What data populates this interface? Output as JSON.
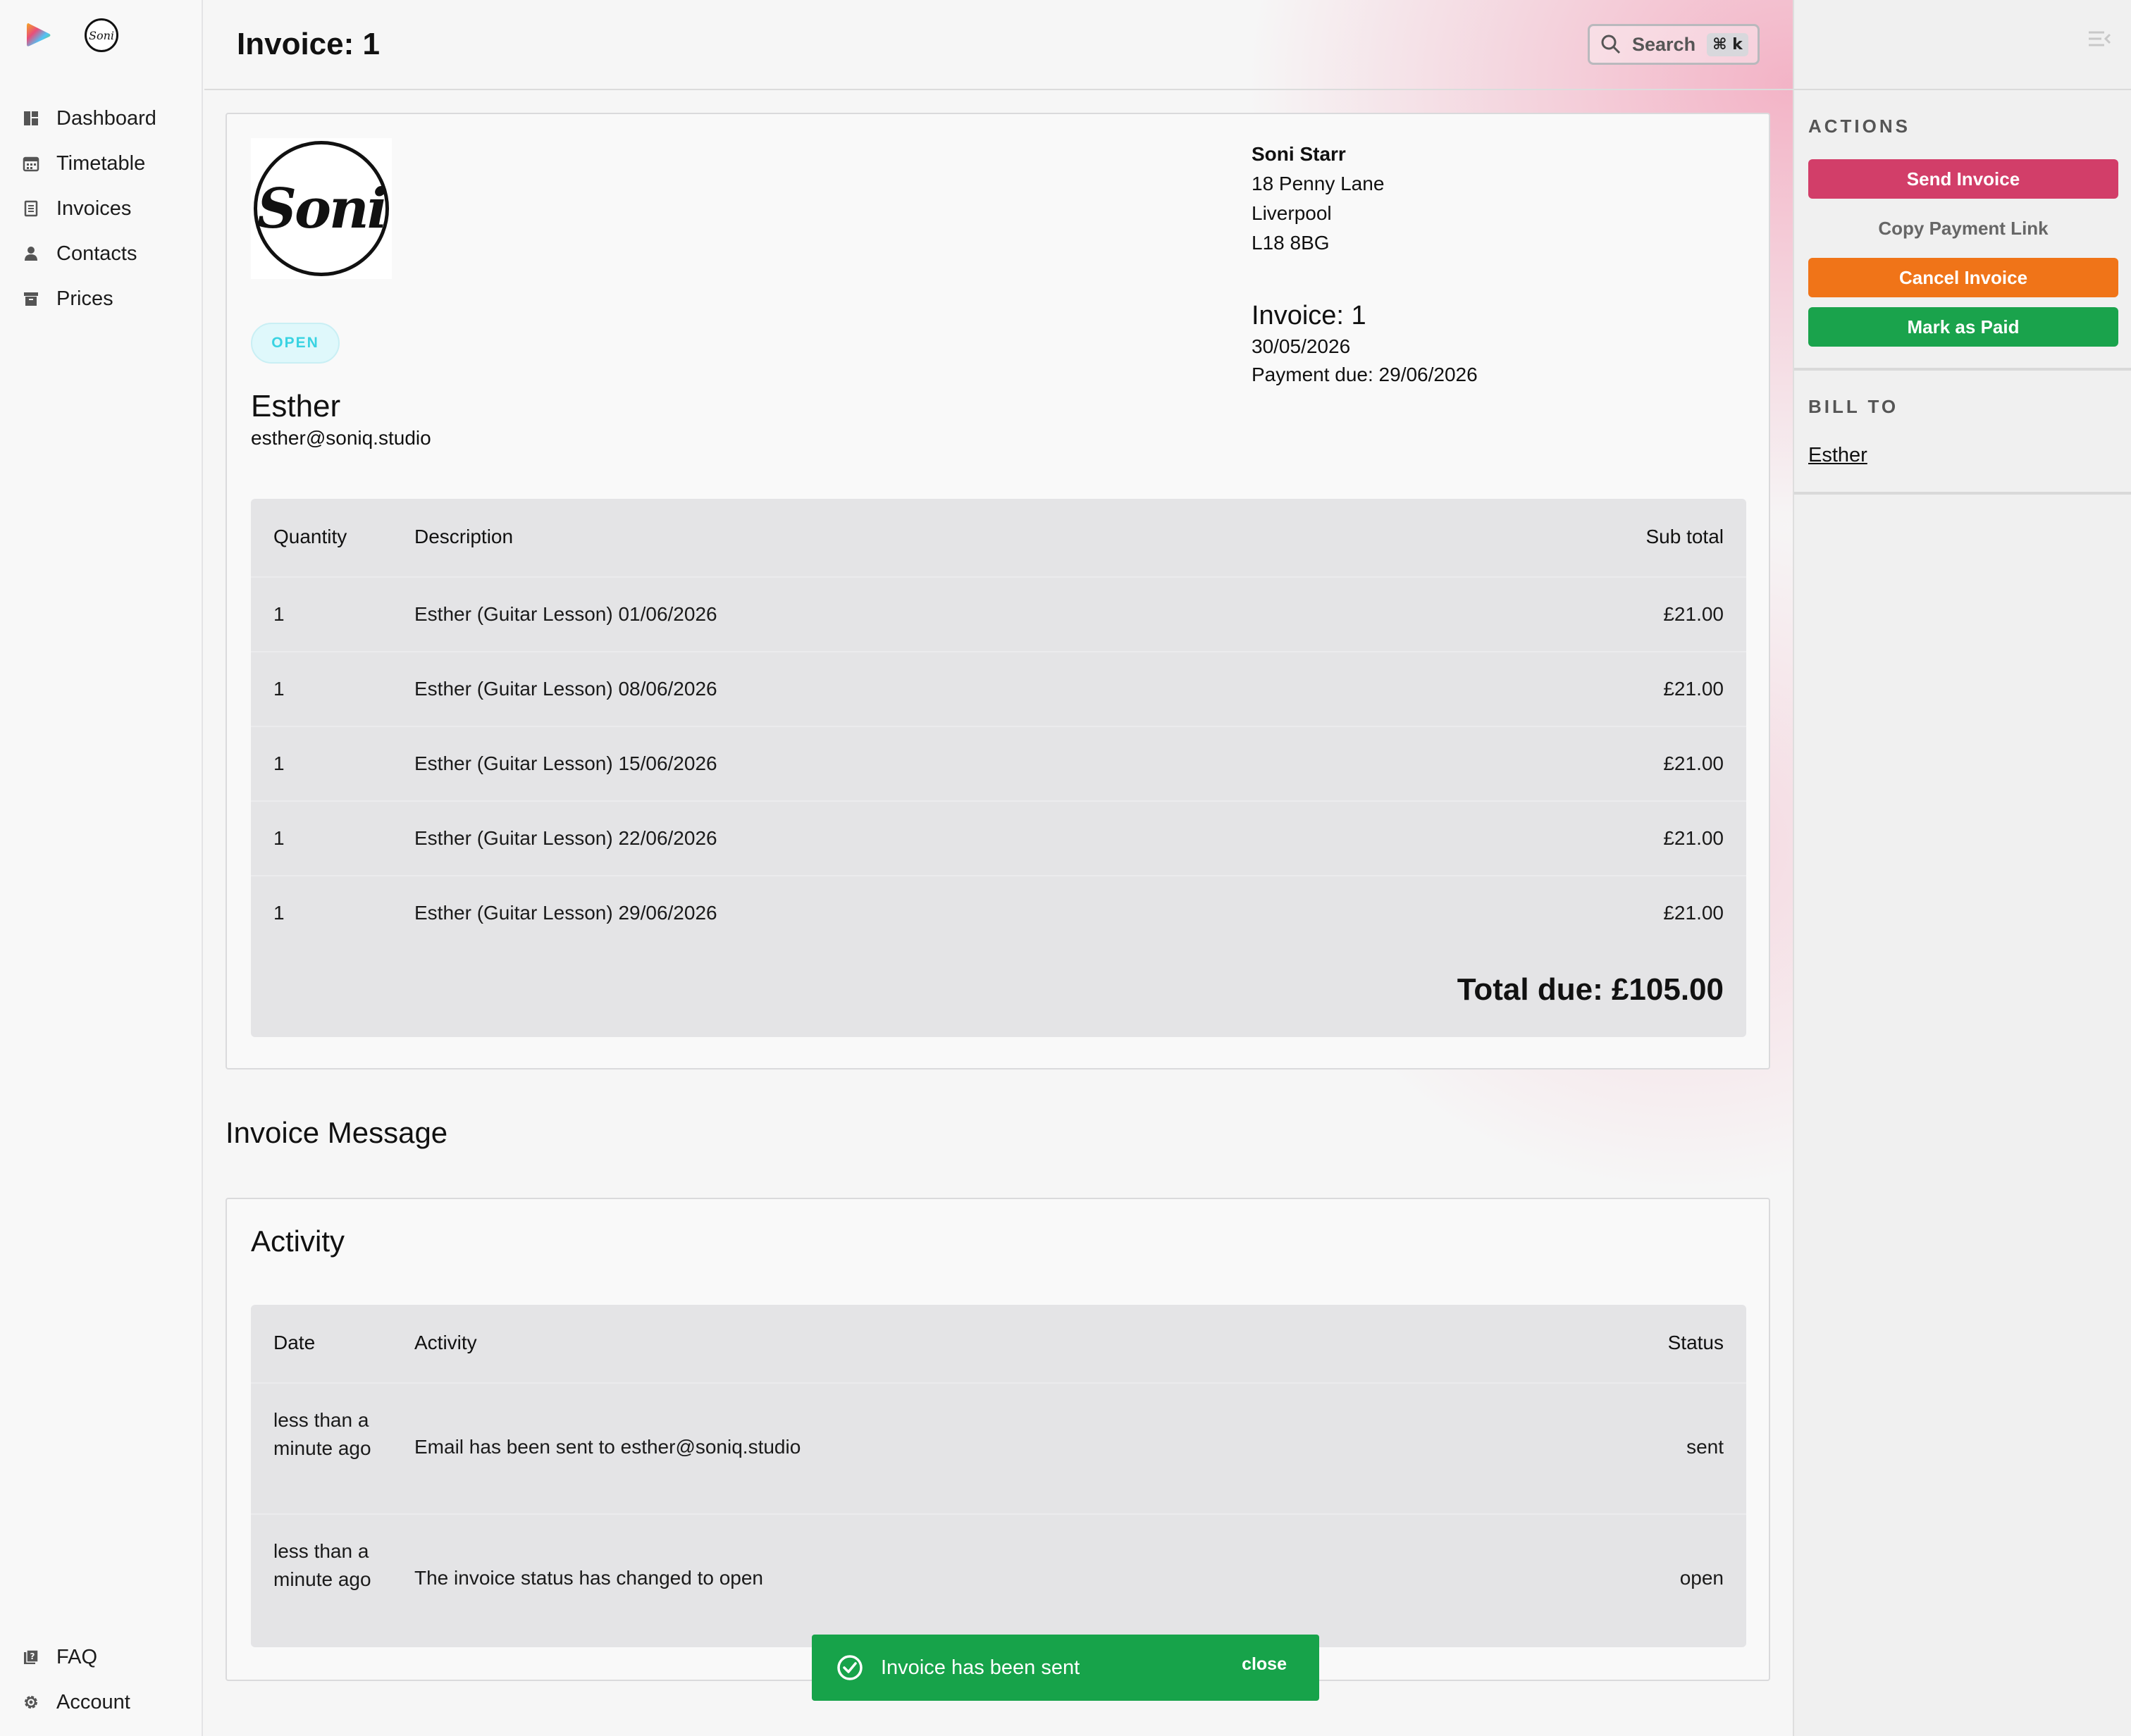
{
  "sidebar": {
    "items": [
      {
        "label": "Dashboard",
        "icon": "dashboard-icon"
      },
      {
        "label": "Timetable",
        "icon": "calendar-icon"
      },
      {
        "label": "Invoices",
        "icon": "invoice-icon"
      },
      {
        "label": "Contacts",
        "icon": "person-icon"
      },
      {
        "label": "Prices",
        "icon": "archive-icon"
      }
    ],
    "bottom": [
      {
        "label": "FAQ",
        "icon": "faq-icon"
      },
      {
        "label": "Account",
        "icon": "gear-icon"
      }
    ]
  },
  "header": {
    "title": "Invoice: 1",
    "search_label": "Search",
    "search_shortcut": "⌘ k"
  },
  "invoice": {
    "logo_text": "Soni",
    "status": "OPEN",
    "client_name": "Esther",
    "client_email": "esther@soniq.studio",
    "from": {
      "name": "Soni Starr",
      "address1": "18 Penny Lane",
      "city": "Liverpool",
      "postcode": "L18 8BG"
    },
    "number_label": "Invoice: 1",
    "date": "30/05/2026",
    "payment_due": "Payment due: 29/06/2026",
    "table": {
      "headers": [
        "Quantity",
        "Description",
        "Sub total"
      ],
      "rows": [
        [
          "1",
          "Esther (Guitar Lesson) 01/06/2026",
          "£21.00"
        ],
        [
          "1",
          "Esther (Guitar Lesson) 08/06/2026",
          "£21.00"
        ],
        [
          "1",
          "Esther (Guitar Lesson) 15/06/2026",
          "£21.00"
        ],
        [
          "1",
          "Esther (Guitar Lesson) 22/06/2026",
          "£21.00"
        ],
        [
          "1",
          "Esther (Guitar Lesson) 29/06/2026",
          "£21.00"
        ]
      ],
      "total": "Total due: £105.00"
    }
  },
  "message_title": "Invoice Message",
  "activity": {
    "title": "Activity",
    "headers": [
      "Date",
      "Activity",
      "Status"
    ],
    "rows": [
      [
        "less than a minute ago",
        "Email has been sent to esther@soniq.studio",
        "sent"
      ],
      [
        "less than a minute ago",
        "The invoice status has changed to open",
        "open"
      ]
    ]
  },
  "actions": {
    "label": "ACTIONS",
    "send": "Send Invoice",
    "copy": "Copy Payment Link",
    "cancel": "Cancel Invoice",
    "paid": "Mark as Paid"
  },
  "bill_to": {
    "label": "BILL TO",
    "name": "Esther"
  },
  "toast": {
    "message": "Invoice has been sent",
    "close": "close"
  },
  "colors": {
    "send": "#d23e69",
    "cancel": "#f07418",
    "paid": "#1aa34c",
    "toast": "#17a34a",
    "open_status": "#39d3e2"
  }
}
